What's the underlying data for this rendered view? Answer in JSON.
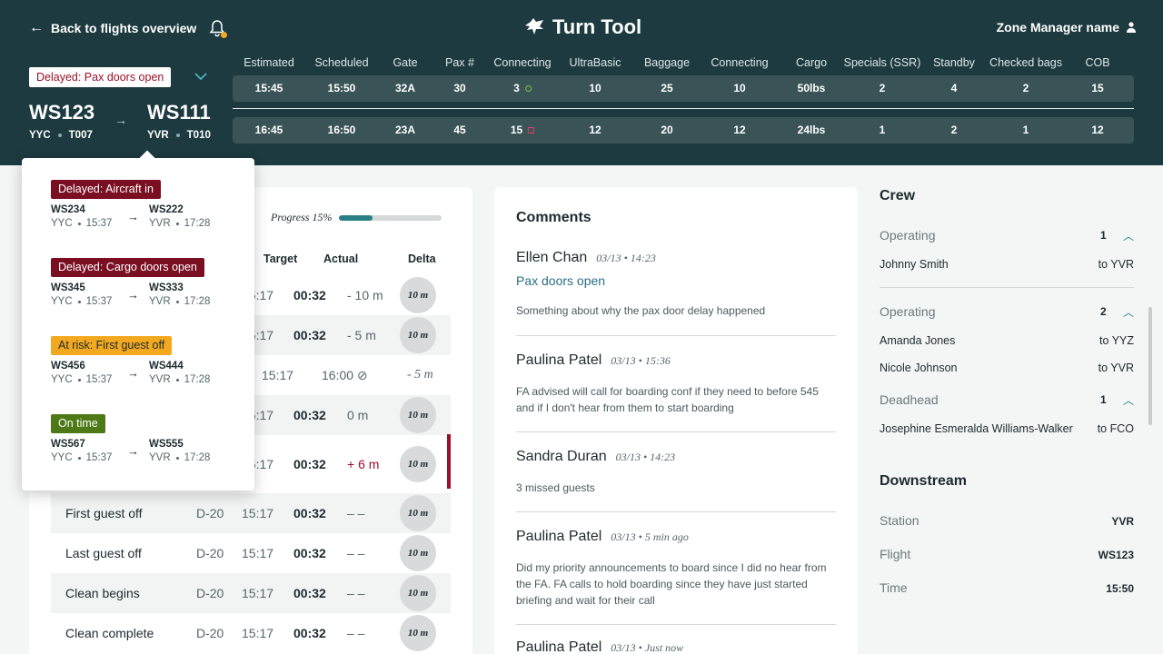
{
  "header": {
    "back_label": "Back to flights overview",
    "app_title": "Turn Tool",
    "user_name": "Zone Manager name",
    "status_pill": "Delayed: Pax doors open",
    "colors": {
      "header_bg": "#1c3a40",
      "delayed": "#9b1029",
      "at_risk": "#f2a91f",
      "on_time": "#4d7a17",
      "accent": "#2a7f86"
    }
  },
  "flight": {
    "inbound": {
      "number": "WS123",
      "airport": "YYC",
      "terminal": "T007"
    },
    "outbound": {
      "number": "WS111",
      "airport": "YVR",
      "terminal": "T010"
    }
  },
  "stats": {
    "columns": [
      "Estimated",
      "Scheduled",
      "Gate",
      "Pax #",
      "Connecting",
      "UltraBasic",
      "Baggage",
      "Connecting",
      "Cargo",
      "Specials (SSR)",
      "Standby",
      "Checked bags",
      "COB"
    ],
    "row1": [
      "15:45",
      "15:50",
      "32A",
      "30",
      "3",
      "10",
      "25",
      "10",
      "50lbs",
      "2",
      "4",
      "2",
      "15"
    ],
    "row2": [
      "16:45",
      "16:50",
      "23A",
      "45",
      "15",
      "12",
      "20",
      "12",
      "24lbs",
      "1",
      "2",
      "1",
      "12"
    ]
  },
  "popover": {
    "items": [
      {
        "status": "Delayed: Aircraft in",
        "color": "#7a0f22",
        "from": "WS234",
        "from_ap": "YYC",
        "from_t": "15:37",
        "to": "WS222",
        "to_ap": "YVR",
        "to_t": "17:28"
      },
      {
        "status": "Delayed: Cargo doors open",
        "color": "#7a0f22",
        "from": "WS345",
        "from_ap": "YYC",
        "from_t": "15:37",
        "to": "WS333",
        "to_ap": "YVR",
        "to_t": "17:28"
      },
      {
        "status": "At risk: First guest off",
        "color": "#f2a91f",
        "from": "WS456",
        "from_ap": "YYC",
        "from_t": "15:37",
        "to": "WS444",
        "to_ap": "YVR",
        "to_t": "17:28"
      },
      {
        "status": "On time",
        "color": "#4d7a17",
        "from": "WS567",
        "from_ap": "YYC",
        "from_t": "15:37",
        "to": "WS555",
        "to_ap": "YVR",
        "to_t": "17:28"
      }
    ]
  },
  "milestones": {
    "progress_label": "Progress 15%",
    "progress_value": 0.32,
    "headers": {
      "target": "Target",
      "actual": "Actual",
      "delta": "Delta"
    },
    "rows": [
      {
        "name": "",
        "d": "",
        "time": "15:17",
        "target": "00:32",
        "actual": "- 10 m",
        "delta": "10 m"
      },
      {
        "name": "",
        "d": "",
        "time": "15:17",
        "target": "00:32",
        "actual": "- 5 m",
        "delta": "10 m"
      },
      {
        "name": "",
        "d": "",
        "time": "15:17",
        "target": "16:00 ⊘",
        "actual": "- 5 m",
        "delta": ""
      },
      {
        "name": "",
        "d": "",
        "time": "15:17",
        "target": "00:32",
        "actual": "0 m",
        "delta": "10 m"
      },
      {
        "name": "",
        "d": "",
        "time": "15:17",
        "target": "00:32",
        "actual": "+ 6 m",
        "delta": "10 m"
      },
      {
        "name": "First guest off",
        "d": "D-20",
        "time": "15:17",
        "target": "00:32",
        "actual": "– –",
        "delta": "10 m"
      },
      {
        "name": "Last guest off",
        "d": "D-20",
        "time": "15:17",
        "target": "00:32",
        "actual": "– –",
        "delta": "10 m"
      },
      {
        "name": "Clean begins",
        "d": "D-20",
        "time": "15:17",
        "target": "00:32",
        "actual": "– –",
        "delta": "10 m"
      },
      {
        "name": "Clean complete",
        "d": "D-20",
        "time": "15:17",
        "target": "00:32",
        "actual": "– –",
        "delta": "10 m"
      }
    ]
  },
  "comments": {
    "title": "Comments",
    "items": [
      {
        "author": "Ellen Chan",
        "when": "03/13 • 14:23",
        "tag": "Pax doors open",
        "body": "Something about why the pax door delay happened"
      },
      {
        "author": "Paulina Patel",
        "when": "03/13 • 15:36",
        "tag": "",
        "body": "FA advised will call for boarding conf if they need to before 545 and if I don't hear from them to start boarding"
      },
      {
        "author": "Sandra Duran",
        "when": "03/13 • 14:23",
        "tag": "",
        "body": "3 missed guests"
      },
      {
        "author": "Paulina Patel",
        "when": "03/13 • 5 min ago",
        "tag": "",
        "body": "Did my priority announcements to board since I did no hear from the FA. FA calls to hold boarding since they have just started briefing and wait for their call"
      },
      {
        "author": "Paulina Patel",
        "when": "03/13 • Just now",
        "tag": "",
        "body": ""
      }
    ]
  },
  "crew": {
    "title": "Crew",
    "groups": [
      {
        "label": "Operating",
        "count": "1",
        "members": [
          {
            "name": "Johnny Smith",
            "to": "to YVR"
          }
        ]
      },
      {
        "label": "Operating",
        "count": "2",
        "members": [
          {
            "name": "Amanda Jones",
            "to": "to YYZ"
          },
          {
            "name": "Nicole Johnson",
            "to": "to YVR"
          }
        ]
      },
      {
        "label": "Deadhead",
        "count": "1",
        "members": [
          {
            "name": "Josephine Esmeralda Williams-Walker",
            "to": "to FCO"
          }
        ]
      }
    ]
  },
  "downstream": {
    "title": "Downstream",
    "rows": [
      {
        "label": "Station",
        "value": "YVR"
      },
      {
        "label": "Flight",
        "value": "WS123"
      },
      {
        "label": "Time",
        "value": "15:50"
      }
    ]
  }
}
